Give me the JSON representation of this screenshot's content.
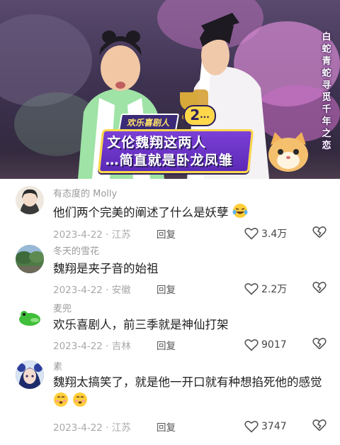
{
  "video": {
    "side_title": [
      "白",
      "蛇",
      "青",
      "蛇",
      "寻",
      "觅",
      "千",
      "年",
      "之",
      "恋"
    ],
    "caption_tag": "欢乐喜剧人",
    "caption_number": "2",
    "caption_lines": [
      "文伦魏翔这两人",
      "…简直就是卧龙凤雏"
    ]
  },
  "comments": [
    {
      "username": "有态度的 Molly",
      "text": "他们两个完美的阐述了什么是妖孽",
      "emoji": "laughing-tears",
      "date": "2023-4-22 · 江苏",
      "reply": "回复",
      "likes": "3.4万"
    },
    {
      "username": "冬天的雪花",
      "text": "魏翔是夹子音的始祖",
      "date": "2023-4-22 · 安徽",
      "reply": "回复",
      "likes": "2.2万"
    },
    {
      "username": "麦兜",
      "text": "欢乐喜剧人，前三季就是神仙打架",
      "date": "2023-4-22 · 吉林",
      "reply": "回复",
      "likes": "9017"
    },
    {
      "username": "素",
      "text": "魏翔太搞笑了，就是他一开口就有种想掐死他的感觉",
      "emoji": "shy-face-x2",
      "date": "2023-4-22 · 江苏",
      "reply": "回复",
      "likes": "3747"
    }
  ],
  "colors": {
    "caption_purple": "#6a33c6",
    "caption_yellow": "#ffd84a",
    "muted_text": "#9a9a9a"
  }
}
